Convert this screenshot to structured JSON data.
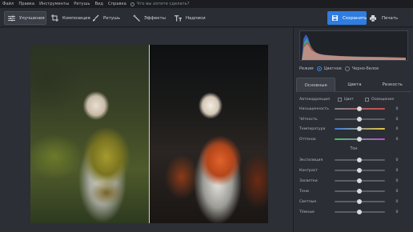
{
  "menu": {
    "items": [
      "Файл",
      "Правка",
      "Инструменты",
      "Ретушь",
      "Вид",
      "Справка"
    ],
    "search_placeholder": "Что вы хотите сделать?"
  },
  "toolbar": {
    "tabs": [
      "Улучшения",
      "Композиция",
      "Ретушь",
      "Эффекты",
      "Надписи"
    ],
    "save_label": "Сохранить",
    "print_label": "Печать"
  },
  "panel": {
    "mode_label": "Режим",
    "mode_color": "Цветное",
    "mode_bw": "Черно-белое",
    "tabs": [
      "Основные",
      "Цвета",
      "Резкость"
    ],
    "autocorrection_label": "Автокоррекция",
    "auto_color": "Цвет",
    "auto_light": "Освещение",
    "sliders_main": [
      {
        "label": "Насыщенность",
        "value": "0"
      },
      {
        "label": "Чёткость",
        "value": "0"
      },
      {
        "label": "Температура",
        "value": "0"
      },
      {
        "label": "Оттенок",
        "value": "0"
      }
    ],
    "tone_header": "Тон",
    "sliders_tone": [
      {
        "label": "Экспозиция",
        "value": "0"
      },
      {
        "label": "Контраст",
        "value": "0"
      },
      {
        "label": "Засветки",
        "value": "0"
      },
      {
        "label": "Тени",
        "value": "0"
      },
      {
        "label": "Светлые",
        "value": "0"
      },
      {
        "label": "Тёмные",
        "value": "0"
      }
    ]
  },
  "colors": {
    "accent": "#2f7de1",
    "temperature_track": [
      "#3a7be0",
      "#e8c33a"
    ],
    "tint_track": [
      "#3cc46a",
      "#c04ad0"
    ],
    "saturation_track": [
      "#7d828b",
      "#d04a4a"
    ]
  }
}
